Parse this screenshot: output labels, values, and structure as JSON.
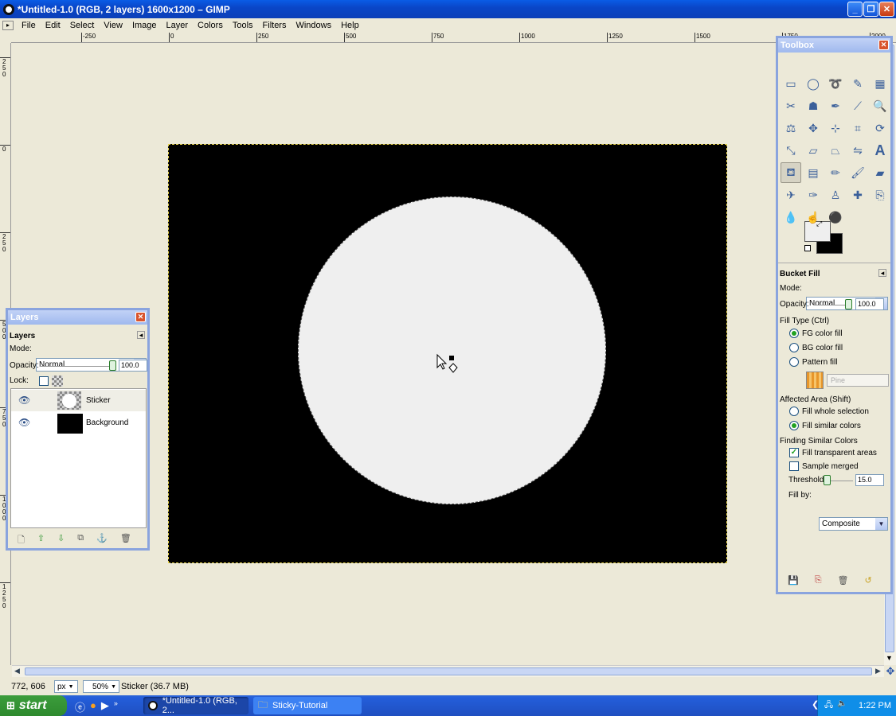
{
  "window": {
    "title": "*Untitled-1.0 (RGB, 2 layers) 1600x1200 – GIMP",
    "minimize": "_",
    "maximize": "❐",
    "close": "✕"
  },
  "menu": [
    "File",
    "Edit",
    "Select",
    "View",
    "Image",
    "Layer",
    "Colors",
    "Tools",
    "Filters",
    "Windows",
    "Help"
  ],
  "hruler_ticks": [
    {
      "label": "-250",
      "pos": -250
    },
    {
      "label": "0",
      "pos": 0
    },
    {
      "label": "250",
      "pos": 250
    },
    {
      "label": "500",
      "pos": 500
    },
    {
      "label": "750",
      "pos": 750
    },
    {
      "label": "1000",
      "pos": 1000
    },
    {
      "label": "1250",
      "pos": 1250
    },
    {
      "label": "1500",
      "pos": 1500
    },
    {
      "label": "1750",
      "pos": 1750
    },
    {
      "label": "2000",
      "pos": 2000
    }
  ],
  "vruler_ticks": [
    {
      "label": "250",
      "pos": -250
    },
    {
      "label": "0",
      "pos": 0
    },
    {
      "label": "250",
      "pos": 250
    },
    {
      "label": "500",
      "pos": 500
    },
    {
      "label": "750",
      "pos": 750
    },
    {
      "label": "1000",
      "pos": 1000
    },
    {
      "label": "1250",
      "pos": 1250
    }
  ],
  "status": {
    "coords": "772, 606",
    "unit": "px",
    "zoom": "50%",
    "layer_info": "Sticker (36.7 MB)"
  },
  "layers_panel": {
    "title": "Layers",
    "header": "Layers",
    "mode_label": "Mode:",
    "mode_value": "Normal",
    "opacity_label": "Opacity:",
    "opacity_value": "100.0",
    "lock_label": "Lock:",
    "layers": [
      {
        "name": "Sticker",
        "visible": true
      },
      {
        "name": "Background",
        "visible": true
      }
    ],
    "buttons": [
      "new-layer-icon",
      "raise-layer-icon",
      "lower-layer-icon",
      "duplicate-layer-icon",
      "anchor-layer-icon",
      "delete-layer-icon"
    ]
  },
  "toolbox": {
    "title": "Toolbox",
    "tools": [
      "rect-select-icon",
      "ellipse-select-icon",
      "lasso-icon",
      "fuzzy-select-icon",
      "color-select-icon",
      "scissors-icon",
      "foreground-select-icon",
      "paths-icon",
      "color-picker-icon",
      "zoom-icon",
      "measure-icon",
      "move-icon",
      "align-icon",
      "crop-icon",
      "rotate-icon",
      "scale-icon",
      "shear-icon",
      "perspective-icon",
      "flip-icon",
      "text-icon",
      "bucket-fill-icon",
      "blend-icon",
      "pencil-icon",
      "paintbrush-icon",
      "eraser-icon",
      "airbrush-icon",
      "ink-icon",
      "clone-icon",
      "heal-icon",
      "perspective-clone-icon",
      "blur-icon",
      "smudge-icon",
      "dodge-burn-icon"
    ],
    "fg_color": "#efefef",
    "bg_color": "#000000"
  },
  "tool_options": {
    "title": "Bucket Fill",
    "mode_label": "Mode:",
    "mode_value": "Normal",
    "opacity_label": "Opacity:",
    "opacity_value": "100.0",
    "fill_type_label": "Fill Type  (Ctrl)",
    "fill_types": [
      {
        "label": "FG color fill",
        "selected": true
      },
      {
        "label": "BG color fill",
        "selected": false
      },
      {
        "label": "Pattern fill",
        "selected": false
      }
    ],
    "pattern_name": "Pine",
    "affected_area_label": "Affected Area  (Shift)",
    "affected_areas": [
      {
        "label": "Fill whole selection",
        "selected": false
      },
      {
        "label": "Fill similar colors",
        "selected": true
      }
    ],
    "finding_label": "Finding Similar Colors",
    "fill_transparent_label": "Fill transparent areas",
    "fill_transparent": true,
    "sample_merged_label": "Sample merged",
    "sample_merged": false,
    "threshold_label": "Threshold:",
    "threshold_value": "15.0",
    "fill_by_label": "Fill by:",
    "fill_by_value": "Composite"
  },
  "taskbar": {
    "start": "start",
    "tasks": [
      {
        "label": "*Untitled-1.0 (RGB, 2...",
        "active": true
      },
      {
        "label": "Sticky-Tutorial",
        "active": false
      }
    ],
    "clock": "1:22 PM"
  }
}
